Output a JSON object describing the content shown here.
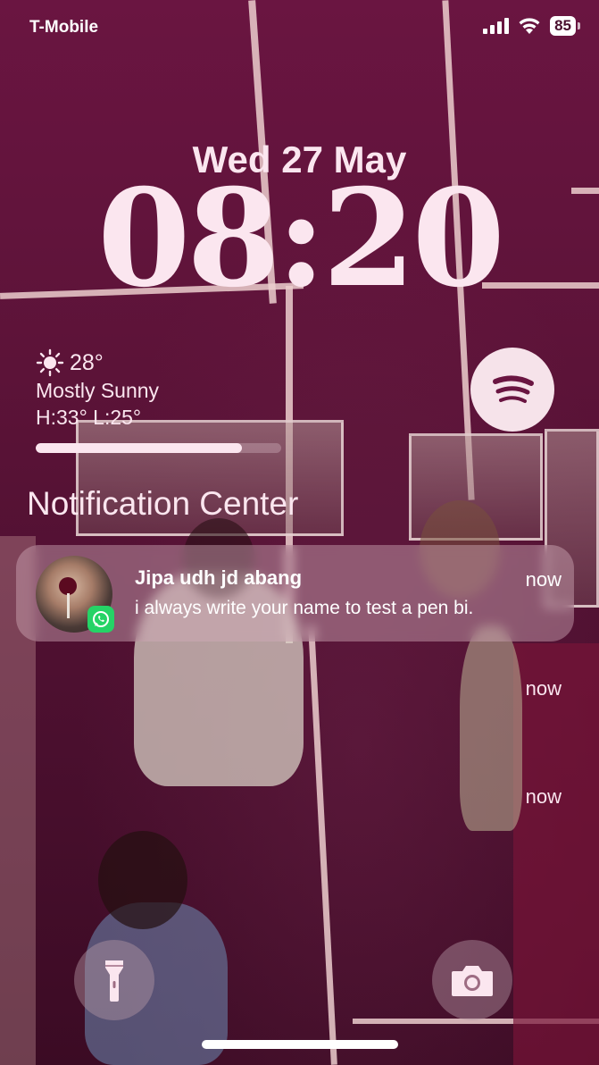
{
  "status_bar": {
    "carrier": "T-Mobile",
    "battery": "85",
    "signal_icon": "cellular-signal-icon",
    "wifi_icon": "wifi-icon"
  },
  "lock_screen": {
    "date": "Wed 27 May",
    "time": "08:20"
  },
  "weather": {
    "icon": "sun-icon",
    "temperature": "28°",
    "condition": "Mostly Sunny",
    "high_low": "H:33° L:25°",
    "daylight_progress": 0.84
  },
  "widgets": {
    "music_app_icon": "spotify-icon"
  },
  "notification_center": {
    "title": "Notification Center",
    "notification": {
      "sender": "Jipa udh jd abang",
      "message": "i always write your name to test a pen bi.",
      "time": "now",
      "app_icon": "whatsapp-icon"
    },
    "stacked_times": [
      "now",
      "now"
    ]
  },
  "quick_actions": {
    "flashlight_icon": "flashlight-icon",
    "camera_icon": "camera-icon"
  },
  "colors": {
    "wallpaper": "#5c1338",
    "text": "#fbe6ef",
    "whatsapp": "#25d366"
  }
}
